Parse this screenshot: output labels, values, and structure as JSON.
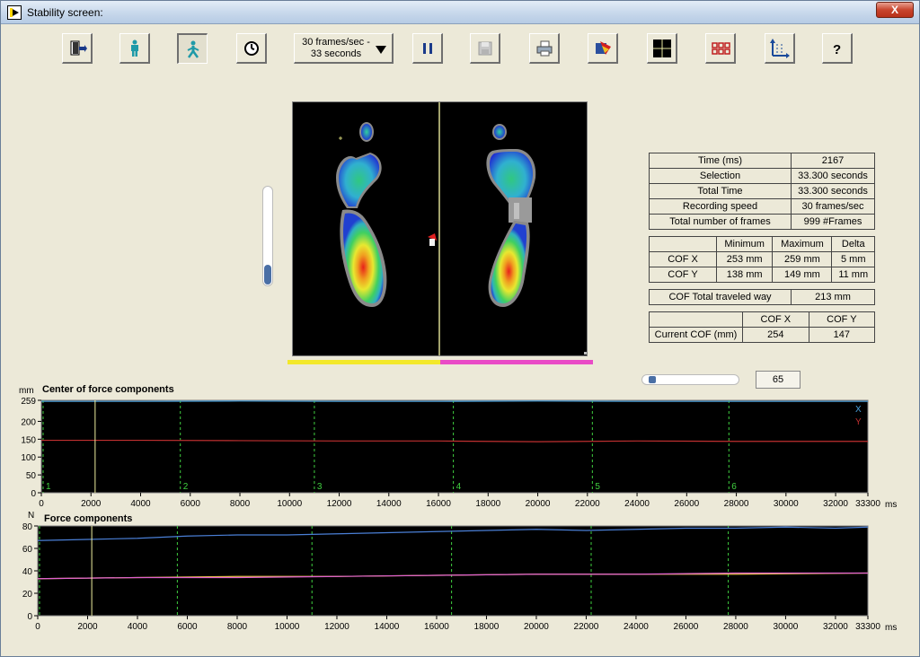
{
  "window": {
    "title": "Stability screen:",
    "close_label": "X"
  },
  "toolbar": {
    "buttons": [
      {
        "name": "exit-button",
        "icon": "exit-door-icon"
      },
      {
        "name": "standing-mode-button",
        "icon": "standing-person-icon"
      },
      {
        "name": "walking-mode-button",
        "icon": "walking-person-icon",
        "pressed": true
      },
      {
        "name": "timer-button",
        "icon": "clock-icon"
      },
      {
        "name": "pause-button",
        "icon": "pause-icon"
      },
      {
        "name": "save-button",
        "icon": "floppy-disk-icon",
        "disabled": true
      },
      {
        "name": "print-button",
        "icon": "printer-icon"
      },
      {
        "name": "export-button",
        "icon": "export-icon"
      },
      {
        "name": "crosshair-view-button",
        "icon": "crosshair-icon"
      },
      {
        "name": "grid-view-button",
        "icon": "grid-icon"
      },
      {
        "name": "graph-axes-button",
        "icon": "axes-chart-icon"
      },
      {
        "name": "help-button",
        "icon": "question-mark-icon"
      }
    ],
    "speed_line1": "30 frames/sec -",
    "speed_line2": "33 seconds"
  },
  "info_table": [
    {
      "label": "Time (ms)",
      "value": "2167"
    },
    {
      "label": "Selection",
      "value": "33.300 seconds"
    },
    {
      "label": "Total Time",
      "value": "33.300 seconds"
    },
    {
      "label": "Recording speed",
      "value": "30 frames/sec"
    },
    {
      "label": "Total number of frames",
      "value": "999 #Frames"
    }
  ],
  "cof_table": {
    "headers": [
      "",
      "Minimum",
      "Maximum",
      "Delta"
    ],
    "rows": [
      {
        "label": "COF X",
        "min": "253 mm",
        "max": "259 mm",
        "delta": "5 mm"
      },
      {
        "label": "COF Y",
        "min": "138 mm",
        "max": "149 mm",
        "delta": "11 mm"
      }
    ]
  },
  "travel": {
    "label": "COF Total traveled way",
    "value": "213 mm"
  },
  "current_cof": {
    "headers": [
      "",
      "COF X",
      "COF Y"
    ],
    "label": "Current COF (mm)",
    "x": "254",
    "y": "147"
  },
  "vertical_slider_level": 0.2,
  "frame_slider_level": 0.04,
  "frame_number": "65",
  "chart_data": [
    {
      "type": "line",
      "title": "Center of force components",
      "ylabel": "mm",
      "xlabel": "ms",
      "ylim": [
        0,
        259
      ],
      "yticks": [
        "259",
        "200",
        "150",
        "100",
        "50",
        "0"
      ],
      "ytick_values": [
        259,
        200,
        150,
        100,
        50,
        0
      ],
      "xlim": [
        0,
        33300
      ],
      "xticks": [
        "0",
        "2000",
        "4000",
        "6000",
        "8000",
        "10000",
        "12000",
        "14000",
        "16000",
        "18000",
        "20000",
        "22000",
        "24000",
        "26000",
        "28000",
        "30000",
        "32000",
        "33300"
      ],
      "xtick_values": [
        0,
        2000,
        4000,
        6000,
        8000,
        10000,
        12000,
        14000,
        16000,
        18000,
        20000,
        22000,
        24000,
        26000,
        28000,
        30000,
        32000,
        33300
      ],
      "cursor_ms": 2167,
      "markers": [
        {
          "label": "1",
          "x": 0
        },
        {
          "label": "2",
          "x": 5600
        },
        {
          "label": "3",
          "x": 11000
        },
        {
          "label": "4",
          "x": 16600
        },
        {
          "label": "5",
          "x": 22200
        },
        {
          "label": "6",
          "x": 27700
        }
      ],
      "series": [
        {
          "name": "X",
          "color": "#4aa3df",
          "x": [
            0,
            4000,
            8000,
            12000,
            16000,
            20000,
            24000,
            28000,
            33300
          ],
          "values": [
            256,
            256,
            257,
            256,
            256,
            257,
            256,
            256,
            256
          ]
        },
        {
          "name": "Y",
          "color": "#c03030",
          "x": [
            0,
            4000,
            8000,
            12000,
            16000,
            20000,
            24000,
            28000,
            33300
          ],
          "values": [
            147,
            147,
            146,
            145,
            145,
            143,
            145,
            144,
            144
          ]
        }
      ]
    },
    {
      "type": "line",
      "title": "Force components",
      "ylabel": "N",
      "xlabel": "ms",
      "ylim": [
        0,
        80
      ],
      "yticks": [
        "80",
        "60",
        "40",
        "20",
        "0"
      ],
      "ytick_values": [
        80,
        60,
        40,
        20,
        0
      ],
      "xlim": [
        0,
        33300
      ],
      "xticks": [
        "0",
        "2000",
        "4000",
        "6000",
        "8000",
        "10000",
        "12000",
        "14000",
        "16000",
        "18000",
        "20000",
        "22000",
        "24000",
        "26000",
        "28000",
        "30000",
        "32000",
        "33300"
      ],
      "xtick_values": [
        0,
        2000,
        4000,
        6000,
        8000,
        10000,
        12000,
        14000,
        16000,
        18000,
        20000,
        22000,
        24000,
        26000,
        28000,
        30000,
        32000,
        33300
      ],
      "cursor_ms": 2167,
      "markers": [
        {
          "label": "",
          "x": 0
        },
        {
          "label": "",
          "x": 5600
        },
        {
          "label": "",
          "x": 11000
        },
        {
          "label": "",
          "x": 16600
        },
        {
          "label": "",
          "x": 22200
        },
        {
          "label": "",
          "x": 27700
        }
      ],
      "series": [
        {
          "color": "#4a7fd6",
          "x": [
            0,
            2000,
            4000,
            6000,
            8000,
            10000,
            12000,
            14000,
            16000,
            18000,
            20000,
            22000,
            24000,
            26000,
            28000,
            30000,
            32000,
            33300
          ],
          "values": [
            67,
            68,
            69,
            71,
            72,
            72,
            73,
            74,
            75,
            76,
            77,
            76,
            77,
            78,
            78,
            79,
            78,
            79
          ]
        },
        {
          "color": "#e8c840",
          "x": [
            0,
            4000,
            8000,
            12000,
            16000,
            20000,
            24000,
            28000,
            33300
          ],
          "values": [
            33,
            34,
            35,
            35,
            36,
            37,
            37,
            37,
            38
          ]
        },
        {
          "color": "#e060d0",
          "x": [
            0,
            4000,
            8000,
            12000,
            16000,
            20000,
            24000,
            28000,
            33300
          ],
          "values": [
            33,
            34,
            34,
            35,
            36,
            37,
            37,
            38,
            38
          ]
        }
      ]
    }
  ]
}
